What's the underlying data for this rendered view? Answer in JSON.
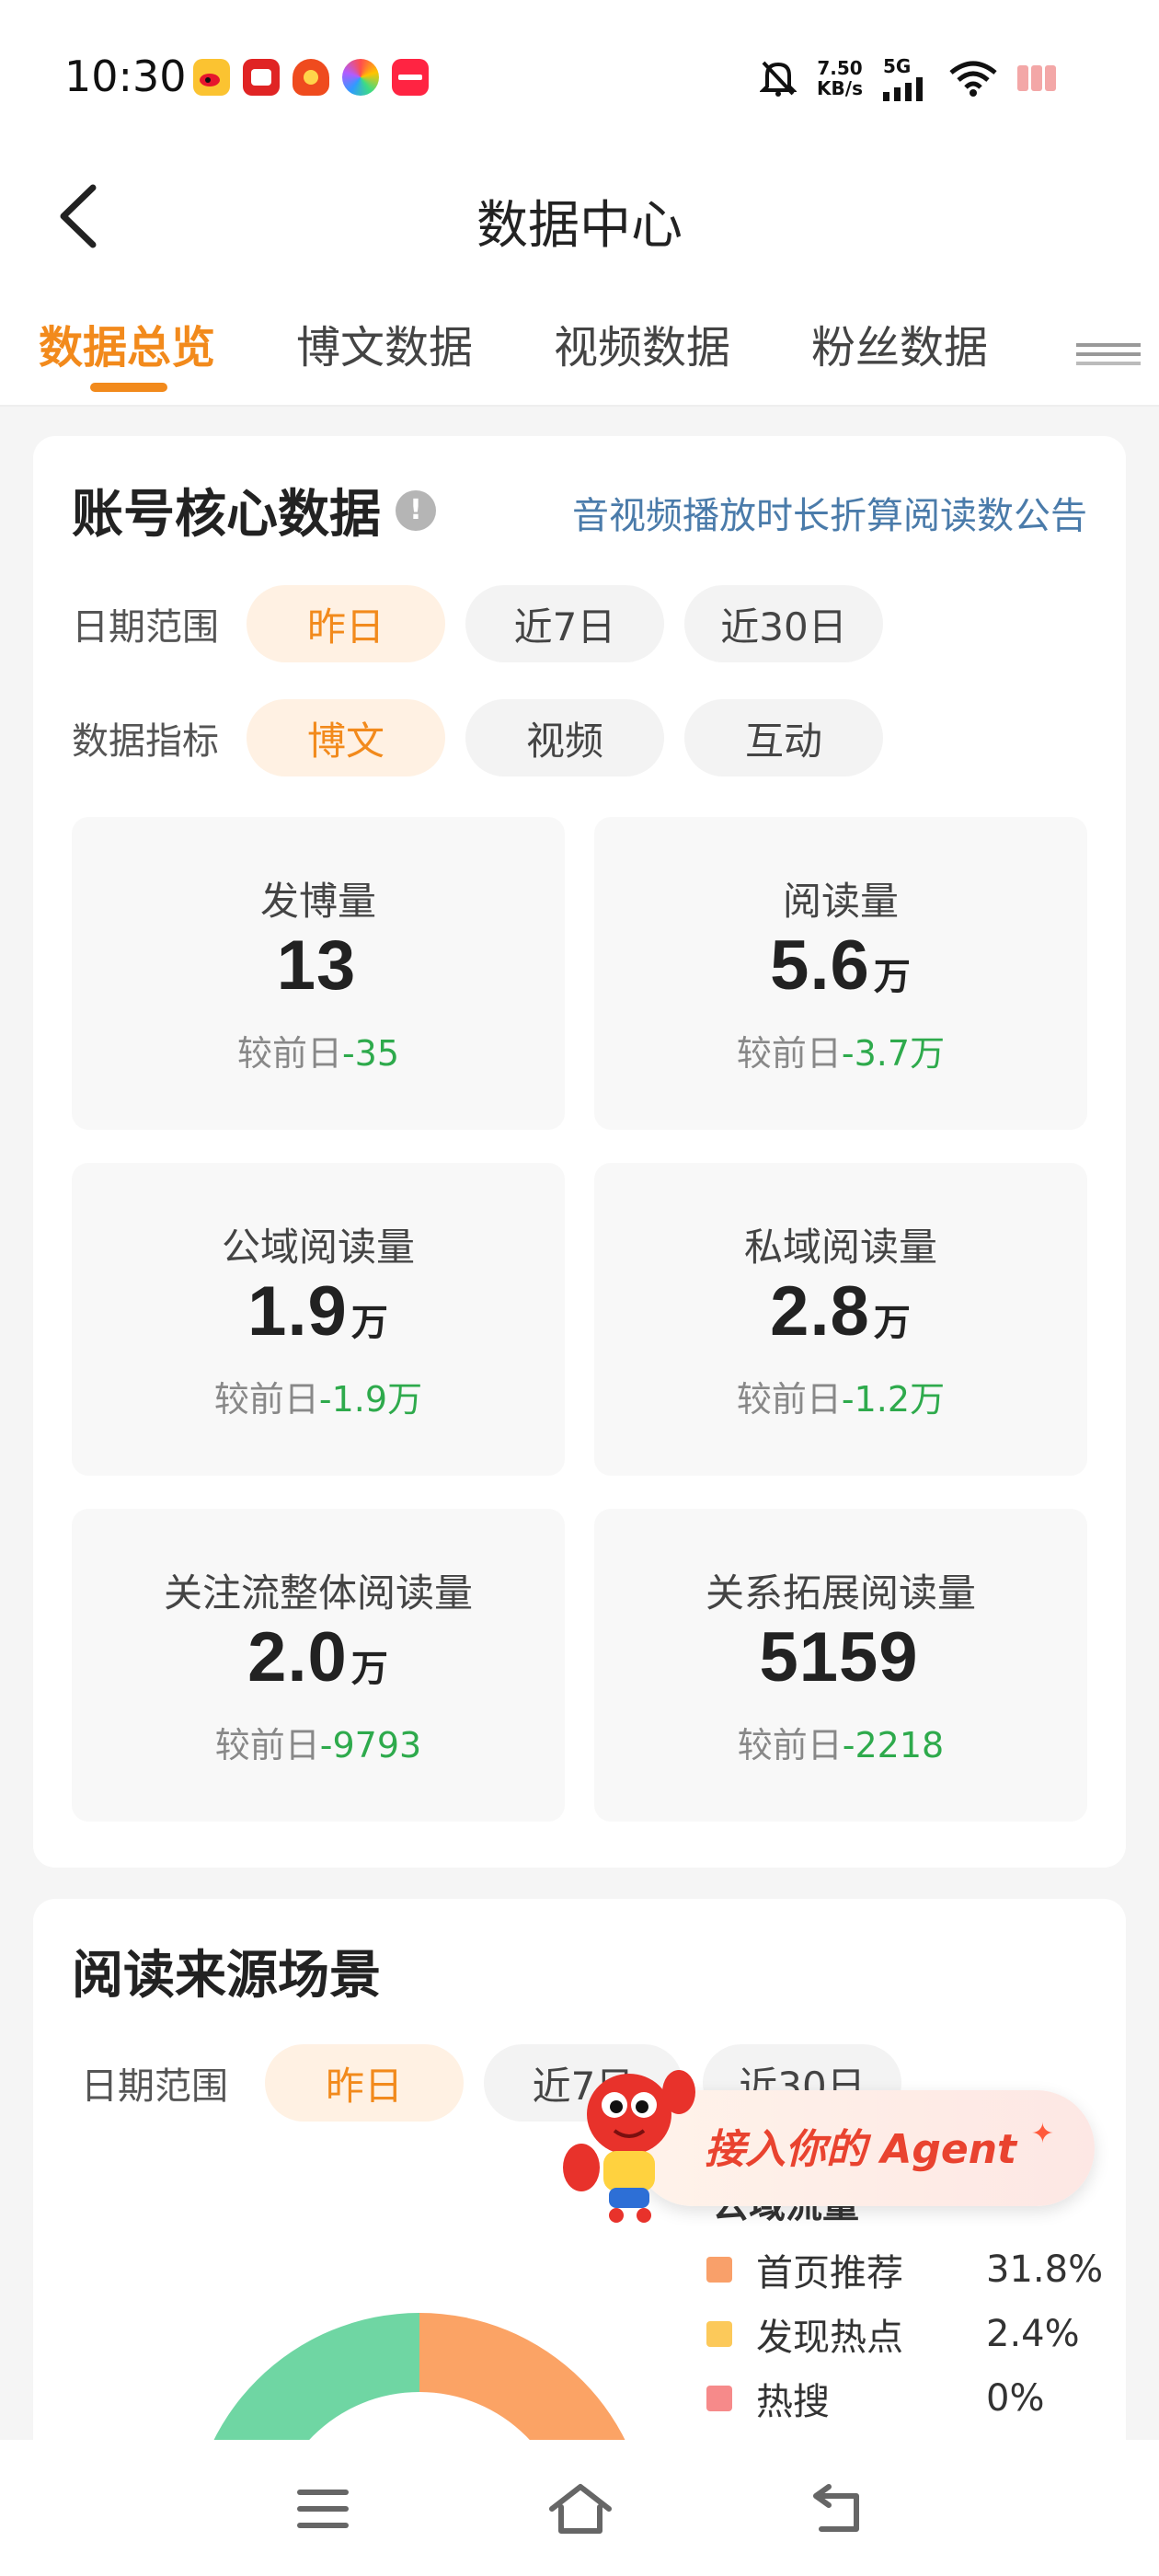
{
  "status_bar": {
    "time": "10:30",
    "speed_value": "7.50",
    "speed_unit": "KB/s",
    "network": "5G",
    "icons": [
      "weibo-icon",
      "app-red-icon",
      "app-orange-icon",
      "photos-icon",
      "xiaohongshu-icon",
      "mute-icon",
      "signal-icon",
      "wifi-icon",
      "battery-icon"
    ]
  },
  "header": {
    "title": "数据中心"
  },
  "tabs": [
    {
      "label": "数据总览",
      "active": true
    },
    {
      "label": "博文数据",
      "active": false
    },
    {
      "label": "视频数据",
      "active": false
    },
    {
      "label": "粉丝数据",
      "active": false
    }
  ],
  "core": {
    "title": "账号核心数据",
    "info_icon": "!",
    "notice_link": "音视频播放时长折算阅读数公告",
    "date_range": {
      "label": "日期范围",
      "options": [
        "昨日",
        "近7日",
        "近30日"
      ],
      "selected": "昨日"
    },
    "metric_type": {
      "label": "数据指标",
      "options": [
        "博文",
        "视频",
        "互动"
      ],
      "selected": "博文"
    },
    "metrics": [
      {
        "label": "发博量",
        "value": "13",
        "unit": "",
        "compare_prefix": "较前日",
        "delta": "-35"
      },
      {
        "label": "阅读量",
        "value": "5.6",
        "unit": "万",
        "compare_prefix": "较前日",
        "delta": "-3.7万"
      },
      {
        "label": "公域阅读量",
        "value": "1.9",
        "unit": "万",
        "compare_prefix": "较前日",
        "delta": "-1.9万"
      },
      {
        "label": "私域阅读量",
        "value": "2.8",
        "unit": "万",
        "compare_prefix": "较前日",
        "delta": "-1.2万"
      },
      {
        "label": "关注流整体阅读量",
        "value": "2.0",
        "unit": "万",
        "compare_prefix": "较前日",
        "delta": "-9793"
      },
      {
        "label": "关系拓展阅读量",
        "value": "5159",
        "unit": "",
        "compare_prefix": "较前日",
        "delta": "-2218"
      }
    ]
  },
  "sources": {
    "title": "阅读来源场景",
    "date_range": {
      "label": "日期范围",
      "options": [
        "昨日",
        "近7日",
        "近30日"
      ],
      "selected": "昨日"
    },
    "legend_title": "公域流量",
    "legend": [
      {
        "name": "首页推荐",
        "value": "31.8%",
        "color": "#f9a06a"
      },
      {
        "name": "发现热点",
        "value": "2.4%",
        "color": "#fcc95a"
      },
      {
        "name": "热搜",
        "value": "0%",
        "color": "#f68a8a"
      }
    ],
    "donut_colors": {
      "orange": "#fba365",
      "green": "#6fd6a3",
      "blue": "#6aa8f0"
    }
  },
  "agent_banner": {
    "text": "接入你的 Agent"
  },
  "nav_bar": {
    "icons": [
      "menu-icon",
      "home-icon",
      "back-nav-icon"
    ]
  }
}
